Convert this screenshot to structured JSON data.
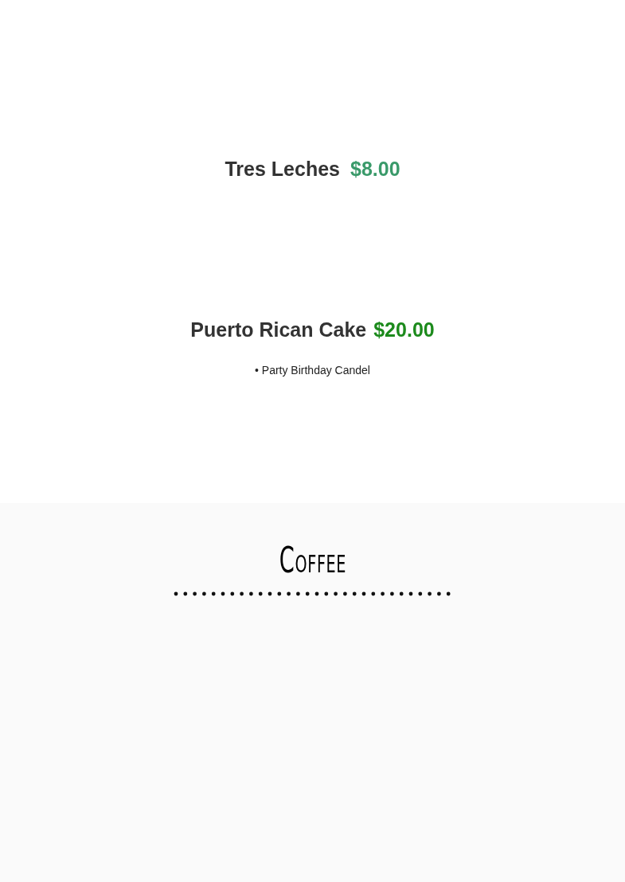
{
  "menu_items": [
    {
      "name": "Tres Leches",
      "price": "$8.00",
      "color": "#3a9a6a"
    },
    {
      "name": "Puerto Rican Cake",
      "price": "$20.00",
      "color": "#1c8a1c",
      "notes": [
        "• Party Birthday Candel"
      ]
    }
  ],
  "section": {
    "title": "Coffee"
  }
}
